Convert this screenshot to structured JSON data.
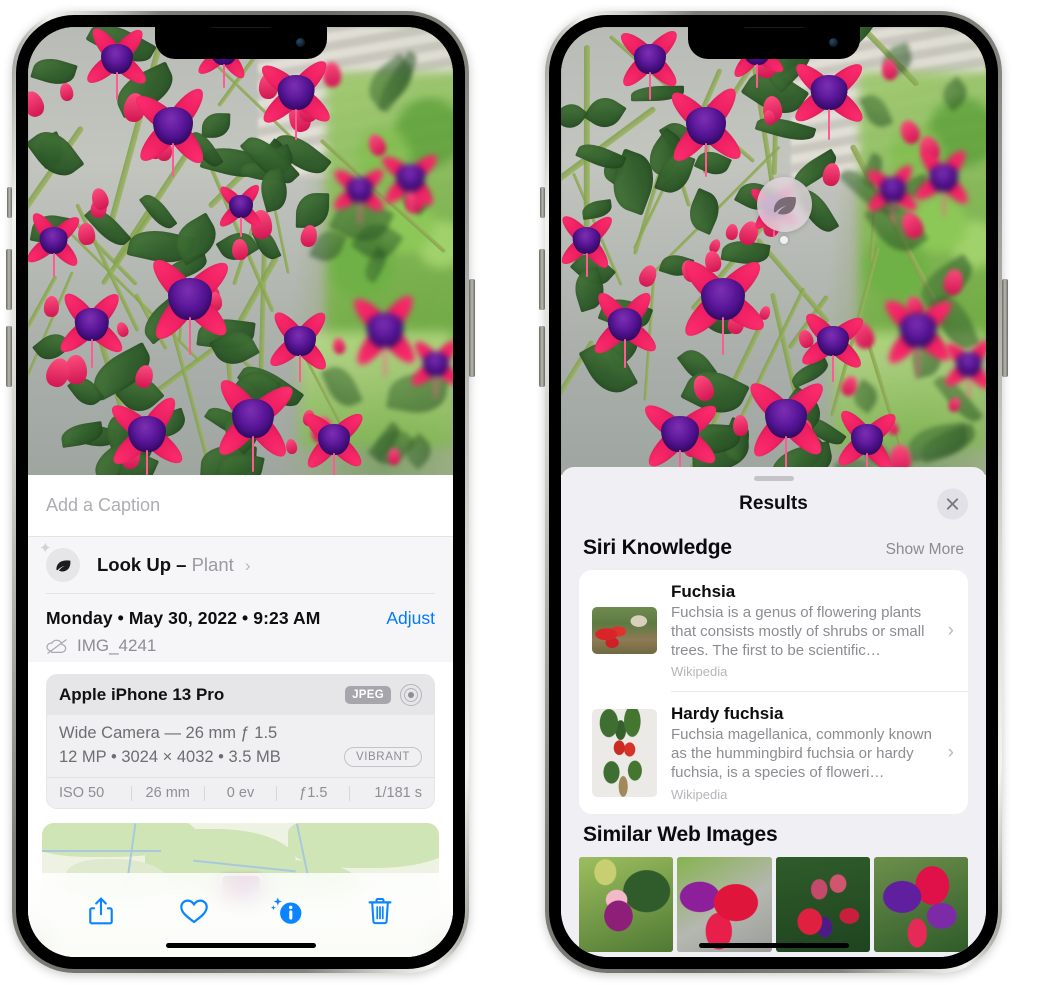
{
  "left_phone": {
    "caption_field": {
      "placeholder": "Add a Caption",
      "value": ""
    },
    "look_up": {
      "label": "Look Up",
      "dash": "–",
      "subject": "Plant",
      "chevron": "›",
      "icon": "leaf-icon",
      "sparkle": "✦"
    },
    "metadata": {
      "date_line": "Monday • May 30, 2022 • 9:23 AM",
      "adjust_label": "Adjust",
      "filename": "IMG_4241",
      "cloud_icon": "icloud-slash-icon"
    },
    "camera_card": {
      "device": "Apple iPhone 13 Pro",
      "format_badge": "JPEG",
      "hdr_icon": "aperture-icon",
      "lens_line": "Wide Camera — 26 mm ƒ 1.5",
      "size_line": "12 MP • 3024 × 4032 • 3.5 MB",
      "style_badge": "VIBRANT",
      "exif": [
        "ISO 50",
        "26 mm",
        "0 ev",
        "ƒ1.5",
        "1/181 s"
      ]
    },
    "toolbar": [
      {
        "name": "share-button",
        "icon": "share-icon"
      },
      {
        "name": "favorite-button",
        "icon": "heart-icon"
      },
      {
        "name": "info-button",
        "icon": "info-sparkle-icon"
      },
      {
        "name": "delete-button",
        "icon": "trash-icon"
      }
    ],
    "colors": {
      "accent": "#007aff",
      "sheet_bg": "#f6f6f8",
      "muted_text": "#8e8e93"
    }
  },
  "right_phone": {
    "visual_lookup_badge": {
      "icon": "leaf-icon"
    },
    "sheet": {
      "title": "Results",
      "close_icon": "close-icon",
      "sections": [
        {
          "title": "Siri Knowledge",
          "action": "Show More",
          "items": [
            {
              "name": "Fuchsia",
              "description": "Fuchsia is a genus of flowering plants that consists mostly of shrubs or small trees. The first to be scientific…",
              "source": "Wikipedia",
              "thumb": "fuchsia-red-flowers-thumbnail",
              "chevron": "›"
            },
            {
              "name": "Hardy fuchsia",
              "description": "Fuchsia magellanica, commonly known as the hummingbird fuchsia or hardy fuchsia, is a species of floweri…",
              "source": "Wikipedia",
              "thumb": "hardy-fuchsia-specimen-thumbnail",
              "chevron": "›"
            }
          ]
        },
        {
          "title": "Similar Web Images",
          "action": "",
          "tiles": [
            "pink-white-fuchsia-leaves",
            "red-magenta-fuchsia-closeup",
            "fuchsia-bush-buds",
            "purple-magenta-fuchsia-cluster"
          ]
        }
      ]
    },
    "colors": {
      "sheet_bg": "#f0eff4",
      "card_bg": "#ffffff",
      "muted_text": "#8c8c92"
    }
  }
}
